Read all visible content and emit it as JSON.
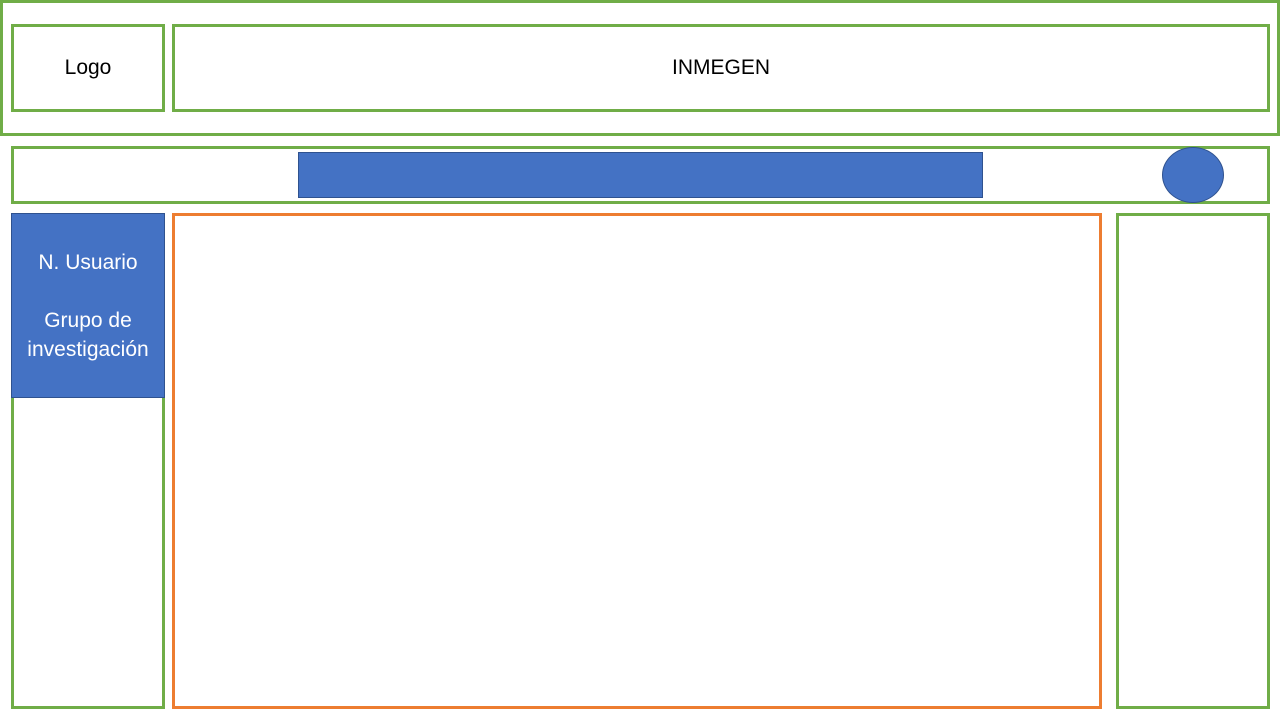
{
  "colors": {
    "frame_green": "#70AD47",
    "content_orange": "#ED7D31",
    "block_blue": "#4472C4",
    "block_blue_border": "#2F528F"
  },
  "header": {
    "logo_label": "Logo",
    "title": "INMEGEN"
  },
  "user_panel": {
    "name_label": "N. Usuario",
    "group_label": "Grupo de investigación"
  }
}
